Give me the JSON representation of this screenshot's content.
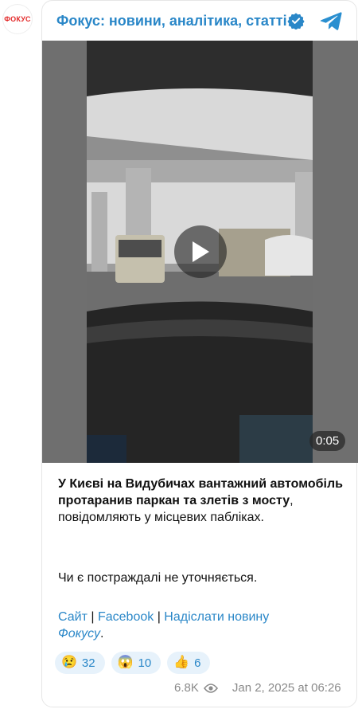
{
  "avatar": {
    "label": "ФОКУС"
  },
  "channel": {
    "title": "Фокус: новини, аналітика, статті",
    "accent": "#2a87c8"
  },
  "video": {
    "duration": "0:05"
  },
  "post": {
    "bold_text": "У Києві на Видубичах вантажний автомобіль протаранив паркан та злетів з мосту",
    "rest_text": ", повідомляють у місцевих пабліках.",
    "para2": "Чи є постраждалі не уточняється."
  },
  "links": {
    "site": "Сайт",
    "sep1": "|",
    "facebook": "Facebook",
    "sep2": "|",
    "submit": "Надіслати новину",
    "brand": "Фокусу",
    "dot": "."
  },
  "reactions": [
    {
      "emoji": "😢",
      "count": "32"
    },
    {
      "emoji": "😱",
      "count": "10"
    },
    {
      "emoji": "👍",
      "count": "6"
    }
  ],
  "meta": {
    "views": "6.8K",
    "date": "Jan 2, 2025 at 06:26"
  }
}
